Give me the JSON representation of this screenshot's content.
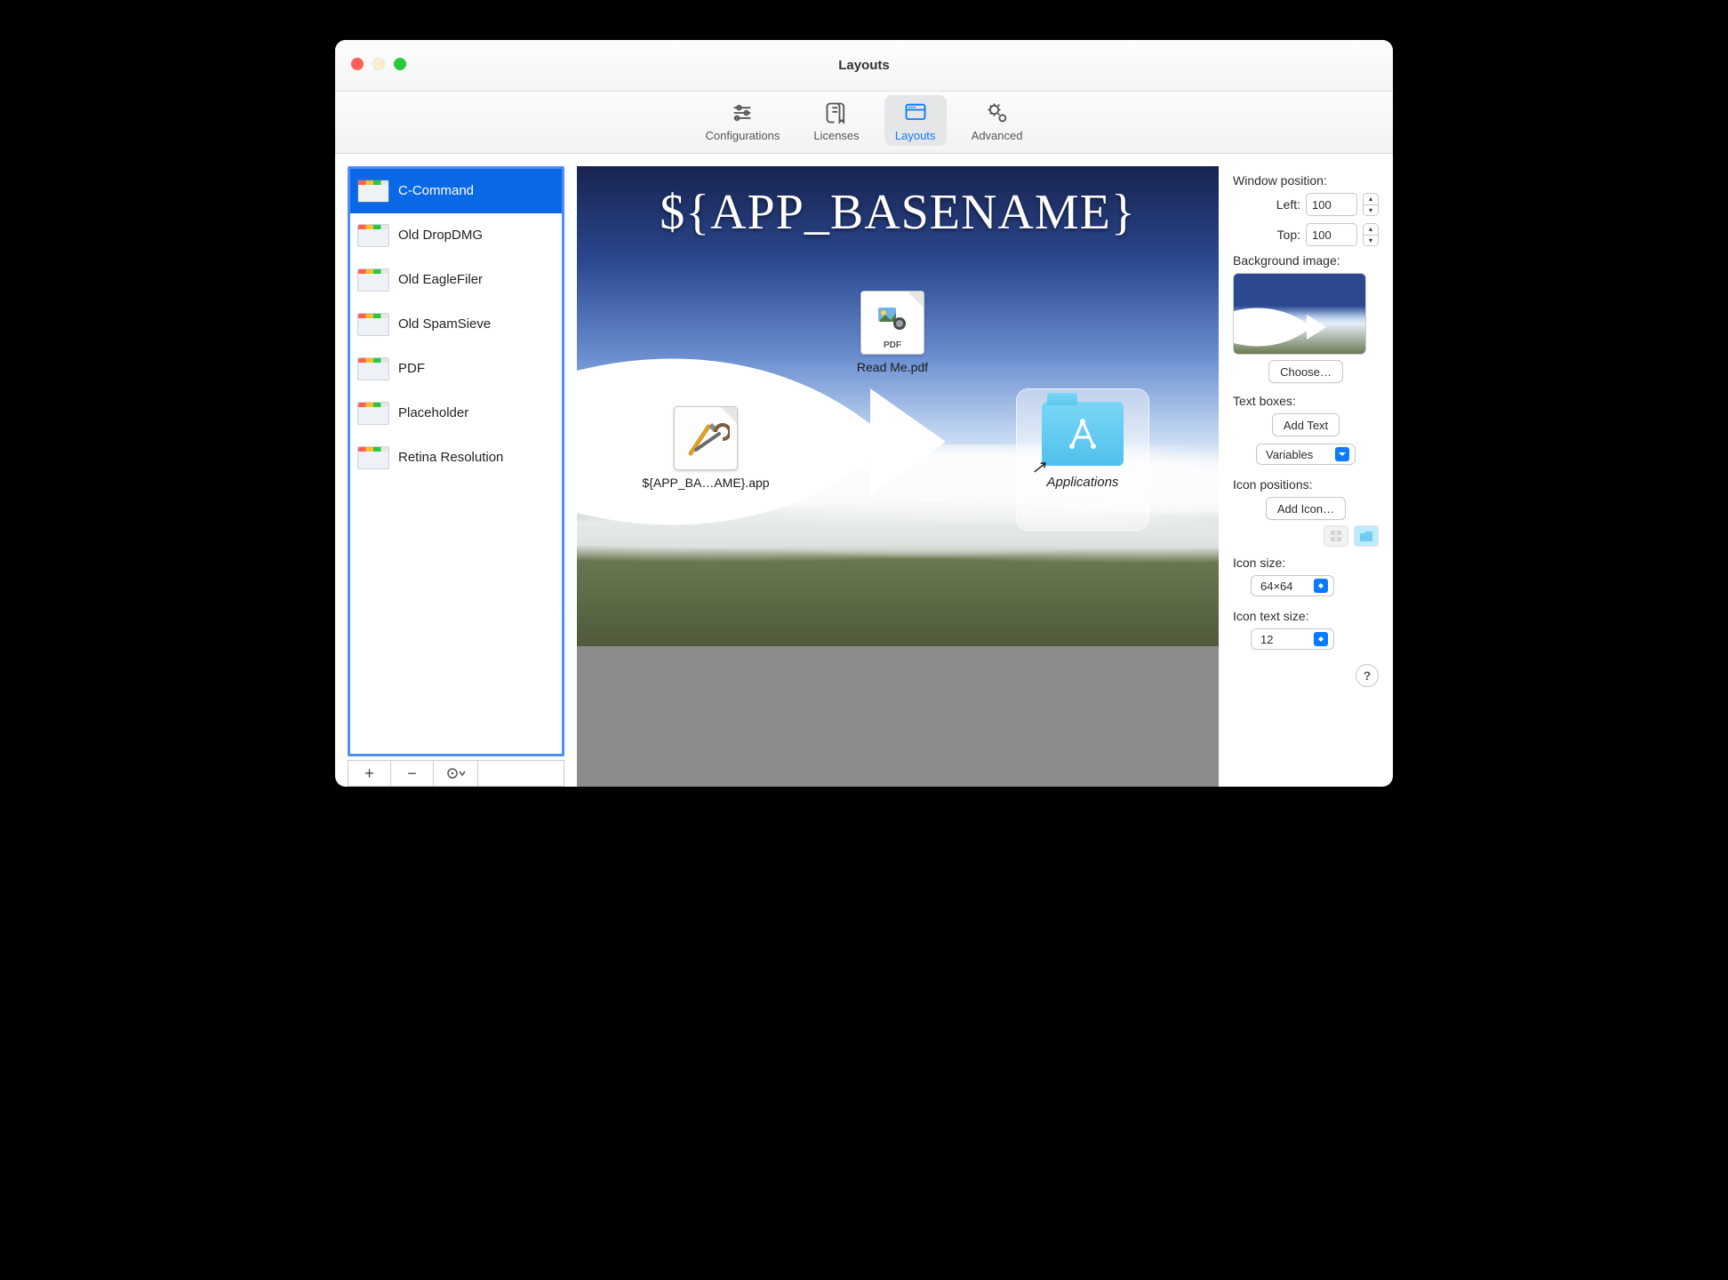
{
  "window": {
    "title": "Layouts"
  },
  "tabs": {
    "configurations": "Configurations",
    "licenses": "Licenses",
    "layouts": "Layouts",
    "advanced": "Advanced",
    "selected": "layouts"
  },
  "sidebar": {
    "items": [
      {
        "label": "C-Command",
        "selected": true
      },
      {
        "label": "Old DropDMG"
      },
      {
        "label": "Old EagleFiler"
      },
      {
        "label": "Old SpamSieve"
      },
      {
        "label": "PDF"
      },
      {
        "label": "Placeholder"
      },
      {
        "label": "Retina Resolution"
      }
    ],
    "footer": {
      "add": "+",
      "remove": "−",
      "actions": "⊙"
    }
  },
  "canvas": {
    "title": "${APP_BASENAME}",
    "items": {
      "readme": {
        "label": "Read Me.pdf",
        "badge": "PDF"
      },
      "app": {
        "label": "${APP_BA…AME}.app"
      },
      "applications": {
        "label": "Applications"
      }
    }
  },
  "panel": {
    "window_position_label": "Window position:",
    "left_label": "Left:",
    "left_value": "100",
    "top_label": "Top:",
    "top_value": "100",
    "background_image_label": "Background image:",
    "choose": "Choose…",
    "text_boxes_label": "Text boxes:",
    "add_text": "Add Text",
    "variables": "Variables",
    "icon_positions_label": "Icon positions:",
    "add_icon": "Add Icon…",
    "icon_size_label": "Icon size:",
    "icon_size_value": "64×64",
    "icon_text_size_label": "Icon text size:",
    "icon_text_size_value": "12",
    "help": "?"
  }
}
